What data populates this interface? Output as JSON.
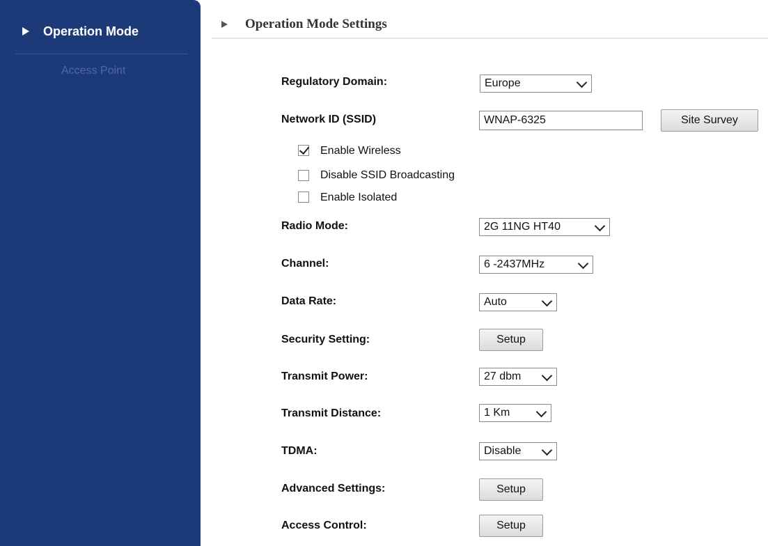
{
  "sidebar": {
    "active_item": "Operation Mode",
    "sub_item": "Access Point"
  },
  "header": {
    "title": "Operation Mode Settings"
  },
  "form": {
    "regulatory_domain": {
      "label": "Regulatory Domain:",
      "value": "Europe"
    },
    "ssid": {
      "label": "Network ID (SSID)",
      "value": "WNAP-6325",
      "button": "Site Survey"
    },
    "checkboxes": [
      {
        "label": "Enable Wireless",
        "checked": true
      },
      {
        "label": "Disable SSID Broadcasting",
        "checked": false
      },
      {
        "label": "Enable Isolated",
        "checked": false
      }
    ],
    "radio_mode": {
      "label": "Radio Mode:",
      "value": "2G 11NG HT40"
    },
    "channel": {
      "label": "Channel:",
      "value": "6 -2437MHz"
    },
    "data_rate": {
      "label": "Data Rate:",
      "value": "Auto"
    },
    "security_setting": {
      "label": "Security Setting:",
      "button": "Setup"
    },
    "transmit_power": {
      "label": "Transmit Power:",
      "value": "27 dbm"
    },
    "transmit_distance": {
      "label": "Transmit Distance:",
      "value": "1 Km"
    },
    "tdma": {
      "label": "TDMA:",
      "value": "Disable"
    },
    "advanced_settings": {
      "label": "Advanced Settings:",
      "button": "Setup"
    },
    "access_control": {
      "label": "Access Control:",
      "button": "Setup"
    }
  },
  "colors": {
    "sidebar_bg": "#1d3a78",
    "sidebar_sub_text": "#4e6aa3"
  }
}
